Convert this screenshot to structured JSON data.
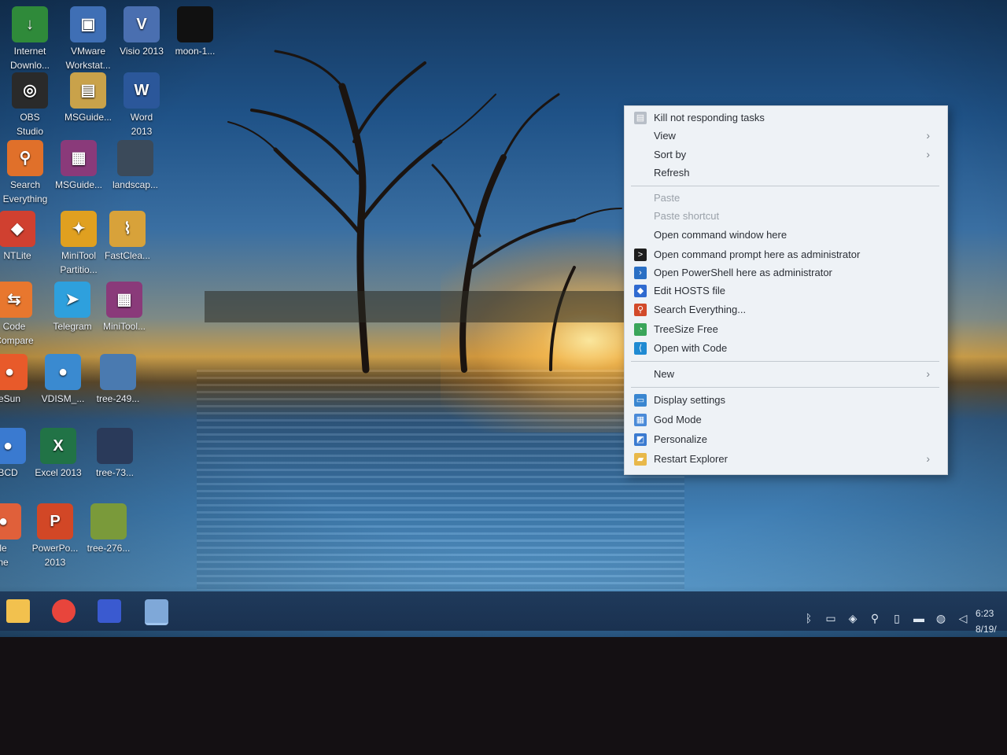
{
  "desktop": {
    "icons": [
      {
        "label": "Internet\nDownlo...",
        "icon": "idm-icon",
        "color": "#2f8a3a"
      },
      {
        "label": "VMware\nWorkstat...",
        "icon": "vmware-icon",
        "color": "#3f6fb5"
      },
      {
        "label": "Visio 2013",
        "icon": "visio-icon",
        "color": "#4a6fb0"
      },
      {
        "label": "moon-1...",
        "icon": "image-file-icon",
        "color": "#111111"
      },
      {
        "label": "OBS\nStudio",
        "icon": "obs-icon",
        "color": "#2a2a2a"
      },
      {
        "label": "MSGuide...",
        "icon": "archive-icon",
        "color": "#c9a24a"
      },
      {
        "label": "Word\n2013",
        "icon": "word-icon",
        "color": "#2b579a"
      },
      {
        "label": "Search\nEverything",
        "icon": "search-everything-icon",
        "color": "#e0702a"
      },
      {
        "label": "MSGuide...",
        "icon": "winrar-icon",
        "color": "#8a3a7a"
      },
      {
        "label": "landscap...",
        "icon": "image-file-icon",
        "color": "#3b4a5a"
      },
      {
        "label": "NTLite",
        "icon": "ntlite-icon",
        "color": "#d04030"
      },
      {
        "label": "MiniTool\nPartitio...",
        "icon": "minitool-icon",
        "color": "#e0a020"
      },
      {
        "label": "FastClea...",
        "icon": "broom-icon",
        "color": "#d8a23a"
      },
      {
        "label": "Code\nCompare",
        "icon": "code-compare-icon",
        "color": "#e8772e"
      },
      {
        "label": "Telegram",
        "icon": "telegram-icon",
        "color": "#2ea0dd"
      },
      {
        "label": "MiniTool...",
        "icon": "winrar-icon",
        "color": "#8a3a7a"
      },
      {
        "label": "eSun",
        "icon": "app-icon",
        "color": "#e85a2a"
      },
      {
        "label": "VDISM_...",
        "icon": "app-icon",
        "color": "#3a8ad0"
      },
      {
        "label": "tree-249...",
        "icon": "image-file-icon",
        "color": "#4a7ab0"
      },
      {
        "label": "BCD",
        "icon": "app-icon",
        "color": "#3a7ad0"
      },
      {
        "label": "Excel 2013",
        "icon": "excel-icon",
        "color": "#217346"
      },
      {
        "label": "tree-73...",
        "icon": "image-file-icon",
        "color": "#2a3a5a"
      },
      {
        "label": "le\nne",
        "icon": "app-icon",
        "color": "#e0603a"
      },
      {
        "label": "PowerPo...\n2013",
        "icon": "powerpoint-icon",
        "color": "#d24726"
      },
      {
        "label": "tree-276...",
        "icon": "image-file-icon",
        "color": "#7a9a3a"
      }
    ]
  },
  "context_menu": {
    "items": [
      {
        "label": "Kill not responding tasks",
        "icon": "kill-tasks-icon",
        "submenu": false,
        "disabled": false
      },
      {
        "label": "View",
        "icon": "",
        "submenu": true,
        "disabled": false
      },
      {
        "label": "Sort by",
        "icon": "",
        "submenu": true,
        "disabled": false
      },
      {
        "label": "Refresh",
        "icon": "",
        "submenu": false,
        "disabled": false
      },
      {
        "label": "Paste",
        "icon": "",
        "submenu": false,
        "disabled": true
      },
      {
        "label": "Paste shortcut",
        "icon": "",
        "submenu": false,
        "disabled": true
      },
      {
        "label": "Open command window here",
        "icon": "",
        "submenu": false,
        "disabled": false
      },
      {
        "label": "Open command prompt here as administrator",
        "icon": "terminal-icon",
        "submenu": false,
        "disabled": false
      },
      {
        "label": "Open PowerShell here as administrator",
        "icon": "powershell-icon",
        "submenu": false,
        "disabled": false
      },
      {
        "label": "Edit HOSTS file",
        "icon": "shield-icon",
        "submenu": false,
        "disabled": false
      },
      {
        "label": "Search Everything...",
        "icon": "magnifier-icon",
        "submenu": false,
        "disabled": false
      },
      {
        "label": "TreeSize Free",
        "icon": "treesize-icon",
        "submenu": false,
        "disabled": false
      },
      {
        "label": "Open with Code",
        "icon": "vscode-icon",
        "submenu": false,
        "disabled": false
      },
      {
        "label": "New",
        "icon": "",
        "submenu": true,
        "disabled": false
      },
      {
        "label": "Display settings",
        "icon": "display-icon",
        "submenu": false,
        "disabled": false
      },
      {
        "label": "God Mode",
        "icon": "control-panel-icon",
        "submenu": false,
        "disabled": false
      },
      {
        "label": "Personalize",
        "icon": "personalize-icon",
        "submenu": false,
        "disabled": false
      },
      {
        "label": "Restart Explorer",
        "icon": "folder-icon",
        "submenu": true,
        "disabled": false
      }
    ]
  },
  "taskbar": {
    "pinned": [
      {
        "name": "file-explorer-icon",
        "color": "#f2c14e"
      },
      {
        "name": "chrome-icon",
        "color": "#e8453c"
      },
      {
        "name": "media-player-icon",
        "color": "#3a5ad0"
      },
      {
        "name": "app-active-icon",
        "color": "#7fa8d8"
      }
    ],
    "tray": [
      "bluetooth-icon",
      "task-view-icon",
      "defender-icon",
      "search-everything-tray-icon",
      "usb-icon",
      "battery-icon",
      "network-icon",
      "volume-icon"
    ],
    "clock_time": "6:23",
    "clock_date": "8/19/"
  },
  "colors": {
    "menu_background": "#eef2f6",
    "taskbar": "#1a3150",
    "text_disabled": "#9aa1a9"
  }
}
